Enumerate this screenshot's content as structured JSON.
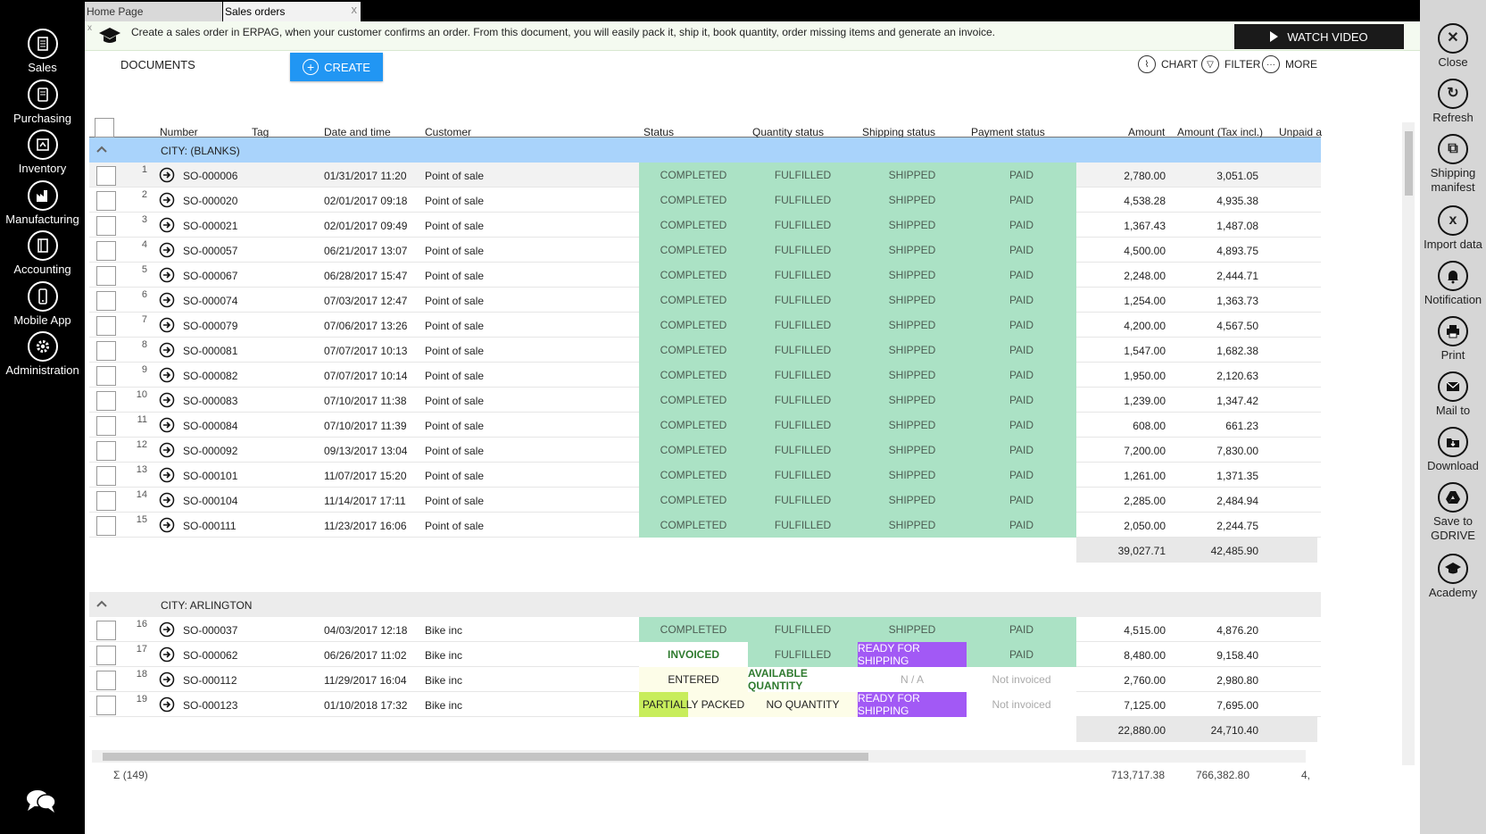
{
  "left_nav": [
    {
      "label": "Sales",
      "icon": "sales-icon"
    },
    {
      "label": "Purchasing",
      "icon": "purchasing-icon"
    },
    {
      "label": "Inventory",
      "icon": "inventory-icon"
    },
    {
      "label": "Manufacturing",
      "icon": "manufacturing-icon"
    },
    {
      "label": "Accounting",
      "icon": "accounting-icon"
    },
    {
      "label": "Mobile App",
      "icon": "mobile-icon"
    },
    {
      "label": "Administration",
      "icon": "gear-icon"
    }
  ],
  "tabs": {
    "home": "Home Page",
    "sales": "Sales orders",
    "close": "x"
  },
  "info": {
    "close": "x",
    "text": "Create a sales order in ERPAG, when your customer confirms an order. From this document, you will easily pack it, ship it, book quantity, order missing items and generate an invoice.",
    "watch_video": "WATCH VIDEO"
  },
  "toolbar": {
    "documents": "DOCUMENTS",
    "create": "CREATE",
    "chart": "CHART",
    "filter": "FILTER",
    "more": "MORE"
  },
  "columns": {
    "number": "Number",
    "tag": "Tag",
    "date": "Date and time",
    "customer": "Customer",
    "status": "Status",
    "quantity_status": "Quantity status",
    "shipping_status": "Shipping status",
    "payment_status": "Payment status",
    "amount": "Amount",
    "amount_tax": "Amount (Tax incl.)",
    "unpaid": "Unpaid a"
  },
  "groups": [
    {
      "label": "CITY: (BLANKS)",
      "totals": {
        "amount": "39,027.71",
        "amount_tax": "42,485.90"
      },
      "rows": [
        {
          "idx": "1",
          "number": "SO-000006",
          "date": "01/31/2017 11:20",
          "customer": "Point of sale",
          "status": "COMPLETED",
          "qty": "FULFILLED",
          "ship": "SHIPPED",
          "pay": "PAID",
          "amount": "2,780.00",
          "amount_tax": "3,051.05"
        },
        {
          "idx": "2",
          "number": "SO-000020",
          "date": "02/01/2017 09:18",
          "customer": "Point of sale",
          "status": "COMPLETED",
          "qty": "FULFILLED",
          "ship": "SHIPPED",
          "pay": "PAID",
          "amount": "4,538.28",
          "amount_tax": "4,935.38"
        },
        {
          "idx": "3",
          "number": "SO-000021",
          "date": "02/01/2017 09:49",
          "customer": "Point of sale",
          "status": "COMPLETED",
          "qty": "FULFILLED",
          "ship": "SHIPPED",
          "pay": "PAID",
          "amount": "1,367.43",
          "amount_tax": "1,487.08"
        },
        {
          "idx": "4",
          "number": "SO-000057",
          "date": "06/21/2017 13:07",
          "customer": "Point of sale",
          "status": "COMPLETED",
          "qty": "FULFILLED",
          "ship": "SHIPPED",
          "pay": "PAID",
          "amount": "4,500.00",
          "amount_tax": "4,893.75"
        },
        {
          "idx": "5",
          "number": "SO-000067",
          "date": "06/28/2017 15:47",
          "customer": "Point of sale",
          "status": "COMPLETED",
          "qty": "FULFILLED",
          "ship": "SHIPPED",
          "pay": "PAID",
          "amount": "2,248.00",
          "amount_tax": "2,444.71"
        },
        {
          "idx": "6",
          "number": "SO-000074",
          "date": "07/03/2017 12:47",
          "customer": "Point of sale",
          "status": "COMPLETED",
          "qty": "FULFILLED",
          "ship": "SHIPPED",
          "pay": "PAID",
          "amount": "1,254.00",
          "amount_tax": "1,363.73"
        },
        {
          "idx": "7",
          "number": "SO-000079",
          "date": "07/06/2017 13:26",
          "customer": "Point of sale",
          "status": "COMPLETED",
          "qty": "FULFILLED",
          "ship": "SHIPPED",
          "pay": "PAID",
          "amount": "4,200.00",
          "amount_tax": "4,567.50"
        },
        {
          "idx": "8",
          "number": "SO-000081",
          "date": "07/07/2017 10:13",
          "customer": "Point of sale",
          "status": "COMPLETED",
          "qty": "FULFILLED",
          "ship": "SHIPPED",
          "pay": "PAID",
          "amount": "1,547.00",
          "amount_tax": "1,682.38"
        },
        {
          "idx": "9",
          "number": "SO-000082",
          "date": "07/07/2017 10:14",
          "customer": "Point of sale",
          "status": "COMPLETED",
          "qty": "FULFILLED",
          "ship": "SHIPPED",
          "pay": "PAID",
          "amount": "1,950.00",
          "amount_tax": "2,120.63"
        },
        {
          "idx": "10",
          "number": "SO-000083",
          "date": "07/10/2017 11:38",
          "customer": "Point of sale",
          "status": "COMPLETED",
          "qty": "FULFILLED",
          "ship": "SHIPPED",
          "pay": "PAID",
          "amount": "1,239.00",
          "amount_tax": "1,347.42"
        },
        {
          "idx": "11",
          "number": "SO-000084",
          "date": "07/10/2017 11:39",
          "customer": "Point of sale",
          "status": "COMPLETED",
          "qty": "FULFILLED",
          "ship": "SHIPPED",
          "pay": "PAID",
          "amount": "608.00",
          "amount_tax": "661.23"
        },
        {
          "idx": "12",
          "number": "SO-000092",
          "date": "09/13/2017 13:04",
          "customer": "Point of sale",
          "status": "COMPLETED",
          "qty": "FULFILLED",
          "ship": "SHIPPED",
          "pay": "PAID",
          "amount": "7,200.00",
          "amount_tax": "7,830.00"
        },
        {
          "idx": "13",
          "number": "SO-000101",
          "date": "11/07/2017 15:20",
          "customer": "Point of sale",
          "status": "COMPLETED",
          "qty": "FULFILLED",
          "ship": "SHIPPED",
          "pay": "PAID",
          "amount": "1,261.00",
          "amount_tax": "1,371.35"
        },
        {
          "idx": "14",
          "number": "SO-000104",
          "date": "11/14/2017 17:11",
          "customer": "Point of sale",
          "status": "COMPLETED",
          "qty": "FULFILLED",
          "ship": "SHIPPED",
          "pay": "PAID",
          "amount": "2,285.00",
          "amount_tax": "2,484.94"
        },
        {
          "idx": "15",
          "number": "SO-000111",
          "date": "11/23/2017 16:06",
          "customer": "Point of sale",
          "status": "COMPLETED",
          "qty": "FULFILLED",
          "ship": "SHIPPED",
          "pay": "PAID",
          "amount": "2,050.00",
          "amount_tax": "2,244.75"
        }
      ]
    },
    {
      "label": "CITY: ARLINGTON",
      "totals": {
        "amount": "22,880.00",
        "amount_tax": "24,710.40"
      },
      "rows": [
        {
          "idx": "16",
          "number": "SO-000037",
          "date": "04/03/2017 12:18",
          "customer": "Bike inc",
          "status": "COMPLETED",
          "qty": "FULFILLED",
          "ship": "SHIPPED",
          "pay": "PAID",
          "amount": "4,515.00",
          "amount_tax": "4,876.20"
        },
        {
          "idx": "17",
          "number": "SO-000062",
          "date": "06/26/2017 11:02",
          "customer": "Bike inc",
          "status": "INVOICED",
          "qty": "FULFILLED",
          "ship": "READY FOR SHIPPING",
          "pay": "PAID",
          "amount": "8,480.00",
          "amount_tax": "9,158.40"
        },
        {
          "idx": "18",
          "number": "SO-000112",
          "date": "11/29/2017 16:04",
          "customer": "Bike inc",
          "status": "ENTERED",
          "qty": "AVAILABLE QUANTITY",
          "ship": "N / A",
          "pay": "Not invoiced",
          "amount": "2,760.00",
          "amount_tax": "2,980.80"
        },
        {
          "idx": "19",
          "number": "SO-000123",
          "date": "01/10/2018 17:32",
          "customer": "Bike inc",
          "status": "PARTIALLY PACKED",
          "qty": "NO QUANTITY",
          "ship": "READY FOR SHIPPING",
          "pay": "Not invoiced",
          "amount": "7,125.00",
          "amount_tax": "7,695.00"
        }
      ]
    }
  ],
  "footer": {
    "count": "Σ (149)",
    "amount": "713,717.38",
    "amount_tax": "766,382.80",
    "unpaid": "4,"
  },
  "right_nav": [
    {
      "label": "Close",
      "icon": "close-icon"
    },
    {
      "label": "Refresh",
      "icon": "refresh-icon"
    },
    {
      "label": "Shipping manifest",
      "icon": "shipping-manifest-icon"
    },
    {
      "label": "Import data",
      "icon": "import-data-icon"
    },
    {
      "label": "Notification",
      "icon": "bell-icon"
    },
    {
      "label": "Print",
      "icon": "print-icon"
    },
    {
      "label": "Mail to",
      "icon": "mail-icon"
    },
    {
      "label": "Download",
      "icon": "download-icon"
    },
    {
      "label": "Save to GDRIVE",
      "icon": "gdrive-icon"
    },
    {
      "label": "Academy",
      "icon": "academy-icon"
    }
  ]
}
